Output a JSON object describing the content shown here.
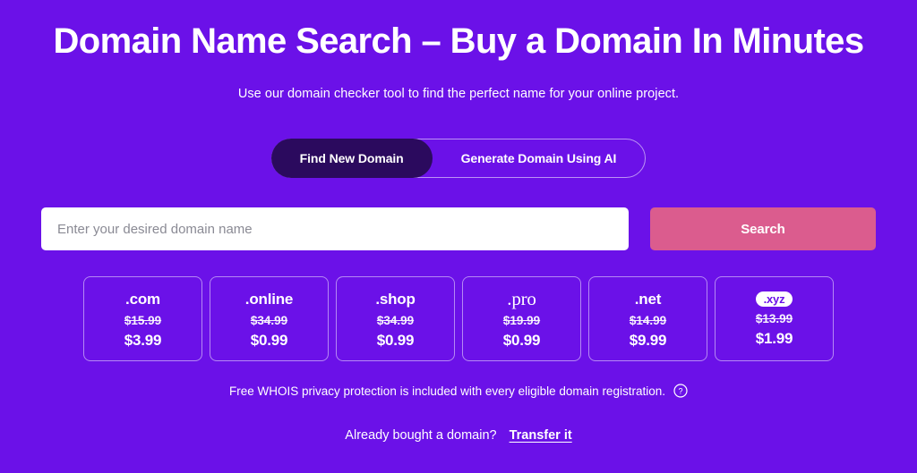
{
  "theme": {
    "background": "#6b11e8",
    "active_tab_bg": "#2b0a5e",
    "search_button_bg": "#db5c8e",
    "text": "#ffffff"
  },
  "header": {
    "title": "Domain Name Search – Buy a Domain In Minutes",
    "subtitle": "Use our domain checker tool to find the perfect name for your online project."
  },
  "tabs": [
    {
      "label": "Find New Domain",
      "active": true
    },
    {
      "label": "Generate Domain Using AI",
      "active": false
    }
  ],
  "search": {
    "placeholder": "Enter your desired domain name",
    "value": "",
    "button_label": "Search"
  },
  "tld_cards": [
    {
      "tld": ".com",
      "style": "dot",
      "old_price": "$15.99",
      "new_price": "$3.99"
    },
    {
      "tld": ".online",
      "style": "plain",
      "old_price": "$34.99",
      "new_price": "$0.99"
    },
    {
      "tld": ".shop",
      "style": "plain",
      "old_price": "$34.99",
      "new_price": "$0.99"
    },
    {
      "tld": ".pro",
      "style": "serif",
      "old_price": "$19.99",
      "new_price": "$0.99"
    },
    {
      "tld": ".net",
      "style": "plain",
      "old_price": "$14.99",
      "new_price": "$9.99"
    },
    {
      "tld": ".xyz",
      "style": "badge",
      "old_price": "$13.99",
      "new_price": "$1.99"
    }
  ],
  "whois": {
    "text": "Free WHOIS privacy protection is included with every eligible domain registration.",
    "icon": "help-circle-icon"
  },
  "transfer": {
    "question": "Already bought a domain?",
    "link_label": "Transfer it"
  }
}
